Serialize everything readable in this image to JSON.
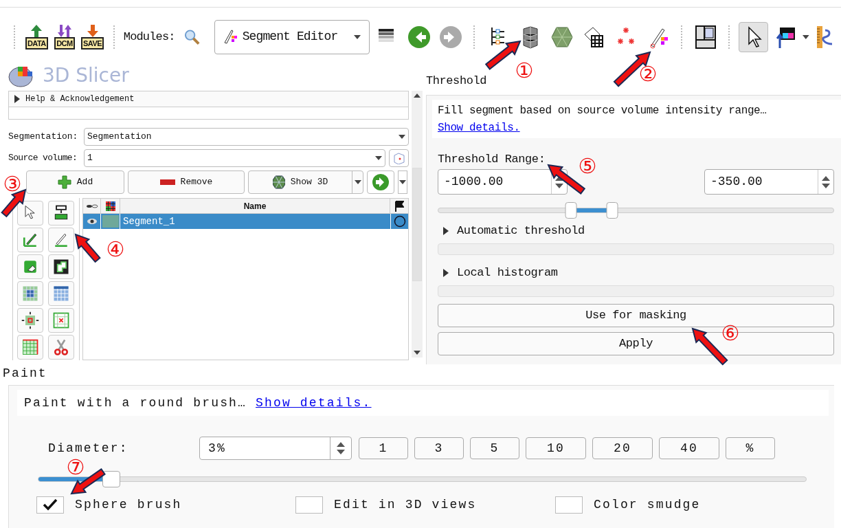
{
  "toolbar": {
    "file_buttons": [
      "DATA",
      "DCM",
      "SAVE"
    ],
    "modules_label": "Modules:",
    "module_select": "Segment Editor"
  },
  "app_title": "3D Slicer",
  "left_panel": {
    "help_section": {
      "label": "Help & Acknowledgement",
      "expanded": false
    },
    "segmentation": {
      "label": "Segmentation:",
      "value": "Segmentation"
    },
    "source_volume": {
      "label": "Source volume:",
      "value": "1"
    },
    "buttons": [
      {
        "kind": "add",
        "label": "Add"
      },
      {
        "kind": "remove",
        "label": "Remove"
      },
      {
        "kind": "show3d",
        "label": "Show 3D"
      }
    ],
    "table": {
      "columns": [
        {
          "label": "Name"
        }
      ],
      "rows": [
        {
          "name": "Segment_1",
          "selected": true,
          "color": "#6fa89a"
        }
      ]
    }
  },
  "threshold": {
    "title": "Threshold",
    "description": "Fill segment based on source volume intensity range…",
    "link": "Show details.",
    "range_label": "Threshold Range:",
    "min_value": "-1000.00",
    "max_value": "-350.00",
    "range_low": {
      "level": 0.336
    },
    "range_high": {
      "level": 0.44
    },
    "sections": [
      {
        "label": "Automatic threshold",
        "expanded": false
      },
      {
        "label": "Local histogram",
        "expanded": false
      }
    ],
    "buttons": [
      "Use for masking",
      "Apply"
    ]
  },
  "paint": {
    "title": "Paint",
    "description": "Paint with a round brush…",
    "link": "Show details.",
    "diameter_label": "Diameter:",
    "diameter_value": "3%",
    "presets": [
      "1",
      "3",
      "5",
      "10",
      "20",
      "40",
      "%"
    ],
    "slider": {
      "level": 0.095
    },
    "checkboxes": [
      {
        "label": "Sphere brush",
        "checked": true
      },
      {
        "label": "Edit in 3D views",
        "checked": false
      },
      {
        "label": "Color smudge",
        "checked": false
      }
    ]
  },
  "annotations": [
    {
      "label": "①"
    },
    {
      "label": "②"
    },
    {
      "label": "③"
    },
    {
      "label": "④"
    },
    {
      "label": "⑤"
    },
    {
      "label": "⑥"
    },
    {
      "label": "⑦"
    }
  ]
}
